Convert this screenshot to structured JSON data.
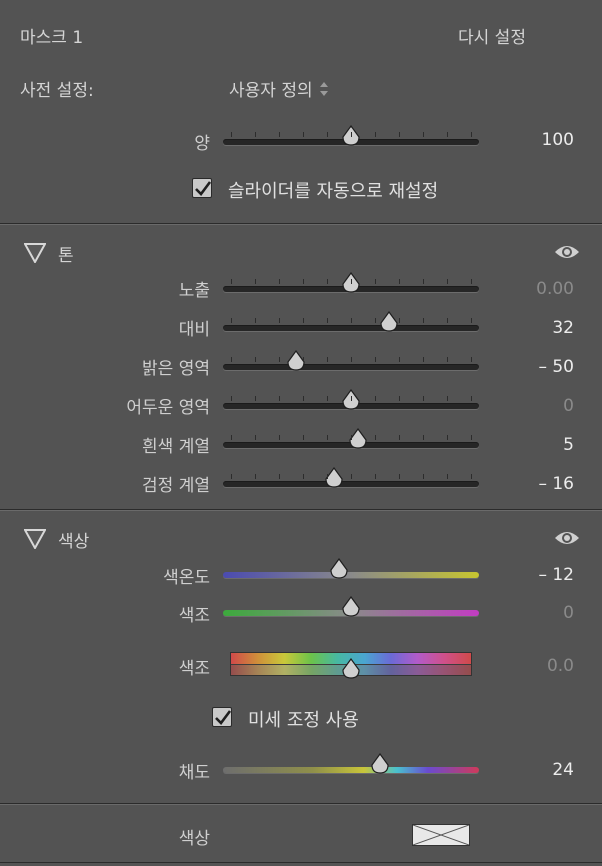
{
  "header": {
    "mask_title": "마스크 1",
    "reset_label": "다시 설정",
    "preset_label": "사전 설정:",
    "preset_value": "사용자 정의",
    "amount_label": "양",
    "amount_value": "100",
    "auto_reset_label": "슬라이더를 자동으로 재설정",
    "auto_reset_checked": true
  },
  "tone": {
    "section_label": "톤",
    "sliders": [
      {
        "label": "노출",
        "value": "0.00",
        "position": 0.5
      },
      {
        "label": "대비",
        "value": "32",
        "position": 0.66
      },
      {
        "label": "밝은 영역",
        "value": "– 50",
        "position": 0.27
      },
      {
        "label": "어두운 영역",
        "value": "0",
        "position": 0.5
      },
      {
        "label": "흰색 계열",
        "value": "5",
        "position": 0.53
      },
      {
        "label": "검정 계열",
        "value": "– 16",
        "position": 0.43
      }
    ]
  },
  "color": {
    "section_label": "색상",
    "temp_label": "색온도",
    "temp_value": "– 12",
    "temp_position": 0.45,
    "tint_label": "색조",
    "tint_value": "0",
    "tint_position": 0.5,
    "hue_label": "색조",
    "hue_value": "0.0",
    "hue_position": 0.5,
    "fine_adjust_label": "미세 조정 사용",
    "fine_adjust_checked": true,
    "saturation_label": "채도",
    "saturation_value": "24",
    "saturation_position": 0.62,
    "color_label": "색상"
  },
  "colors": {
    "panel_bg": "#535353",
    "text": "#d8d8d8",
    "value_dim": "#8a8a8a",
    "value_bright": "#ececec"
  }
}
